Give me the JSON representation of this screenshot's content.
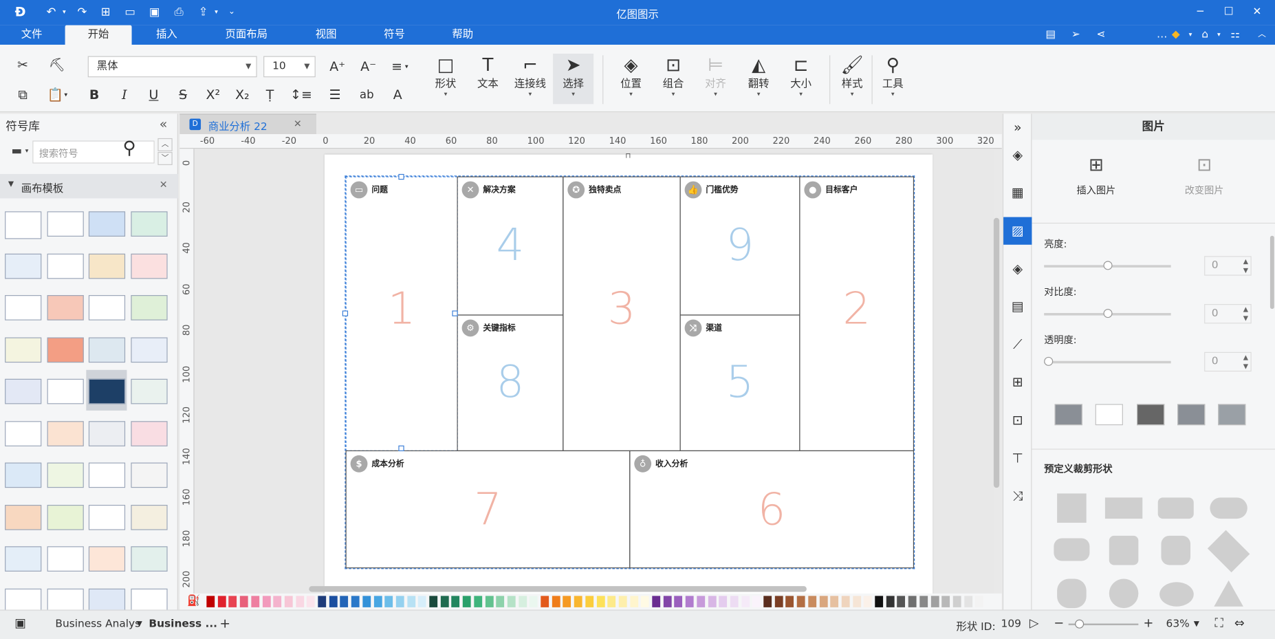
{
  "app": {
    "title": "亿图图示"
  },
  "menu": {
    "tabs": [
      "文件",
      "开始",
      "插入",
      "页面布局",
      "视图",
      "符号",
      "帮助"
    ],
    "active": "开始"
  },
  "ribbon": {
    "font_family": "黑体",
    "font_size": "10",
    "big_buttons": [
      {
        "label": "形状",
        "icon": "rectangle-icon"
      },
      {
        "label": "文本",
        "icon": "text-icon"
      },
      {
        "label": "连接线",
        "icon": "connector-icon"
      },
      {
        "label": "选择",
        "icon": "pointer-icon"
      },
      {
        "label": "位置",
        "icon": "layers-icon"
      },
      {
        "label": "组合",
        "icon": "group-icon"
      },
      {
        "label": "对齐",
        "icon": "align-icon"
      },
      {
        "label": "翻转",
        "icon": "flip-icon"
      },
      {
        "label": "大小",
        "icon": "size-icon"
      },
      {
        "label": "样式",
        "icon": "style-icon"
      },
      {
        "label": "工具",
        "icon": "tools-icon"
      }
    ]
  },
  "left_panel": {
    "title": "符号库",
    "search_placeholder": "搜索符号",
    "section_title": "画布模板"
  },
  "document": {
    "tab_name": "商业分析 22",
    "ruler_h": [
      "-60",
      "-40",
      "-20",
      "0",
      "20",
      "40",
      "60",
      "80",
      "100",
      "120",
      "140",
      "160",
      "180",
      "200",
      "220",
      "240",
      "260",
      "280",
      "300",
      "320"
    ],
    "ruler_v": [
      "0",
      "20",
      "40",
      "60",
      "80",
      "100",
      "120",
      "140",
      "160",
      "180",
      "200"
    ],
    "cells": {
      "problem": {
        "title": "问题",
        "number": "1"
      },
      "solution": {
        "title": "解决方案",
        "number": "4"
      },
      "uvp": {
        "title": "独特卖点",
        "number": "3"
      },
      "advantage": {
        "title": "门槛优势",
        "number": "9"
      },
      "customers": {
        "title": "目标客户",
        "number": "2"
      },
      "metrics": {
        "title": "关键指标",
        "number": "8"
      },
      "channels": {
        "title": "渠道",
        "number": "5"
      },
      "cost": {
        "title": "成本分析",
        "number": "7"
      },
      "revenue": {
        "title": "收入分析",
        "number": "6"
      }
    }
  },
  "palette_colors": [
    "#c00000",
    "#e0212d",
    "#e84352",
    "#e8607a",
    "#ee7fa0",
    "#f29abc",
    "#f4b3cd",
    "#f7c6d6",
    "#f9d7e3",
    "#fbe4ec",
    "#1e3c7a",
    "#1b4fa0",
    "#2264b7",
    "#2a78c9",
    "#3391d8",
    "#48a6e2",
    "#6cbde9",
    "#94d1ef",
    "#b7e1f4",
    "#d7eefa",
    "#1a4a3c",
    "#1f6b50",
    "#23865f",
    "#2aa06b",
    "#3fb47c",
    "#62c28f",
    "#8dd2ab",
    "#b5e2c7",
    "#d6efdf",
    "#eaf7ef",
    "#e25a1c",
    "#ef7d1a",
    "#f59a23",
    "#f8b630",
    "#fbcd3d",
    "#fde15a",
    "#fdea8a",
    "#feefac",
    "#fff5cd",
    "#fffae4",
    "#6a2d91",
    "#8246a8",
    "#9a5fbd",
    "#b17cce",
    "#c79ada",
    "#d8b6e5",
    "#e4ccee",
    "#eddcf3",
    "#f5eaf8",
    "#faf3fb",
    "#5a2e1e",
    "#7b3f25",
    "#9a5530",
    "#b36e43",
    "#c98b5e",
    "#d9a67e",
    "#e6c0a0",
    "#efd4bd",
    "#f6e5d6",
    "#fbf1e9",
    "#111111",
    "#333333",
    "#555555",
    "#6f6f6f",
    "#888888",
    "#a0a0a0",
    "#b8b8b8",
    "#cfcfcf",
    "#e3e3e3",
    "#f3f3f3"
  ],
  "right_panel": {
    "title": "图片",
    "insert_image": "插入图片",
    "change_image": "改变图片",
    "brightness_label": "亮度:",
    "brightness_value": "0",
    "contrast_label": "对比度:",
    "contrast_value": "0",
    "transparency_label": "透明度:",
    "transparency_value": "0",
    "crop_title": "预定义裁剪形状"
  },
  "status": {
    "page_tabs": [
      "Business Analys",
      "Business ..."
    ],
    "shape_id_label": "形状 ID:",
    "shape_id": "109",
    "zoom": "63%"
  }
}
